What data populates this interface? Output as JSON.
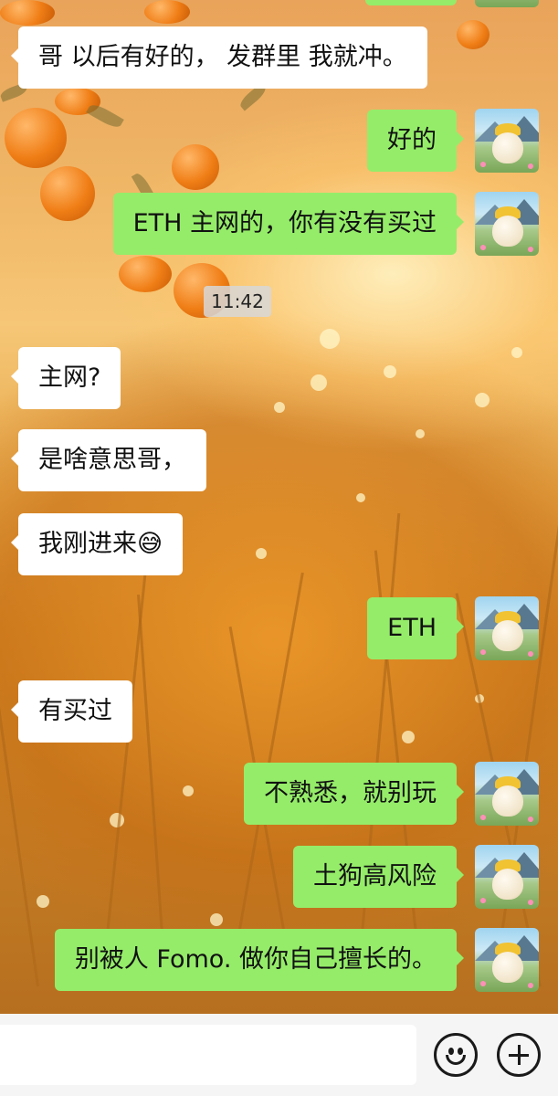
{
  "time_divider": "11:42",
  "messages": [
    {
      "side": "right",
      "text": ""
    },
    {
      "side": "left",
      "text": "哥 以后有好的， 发群里 我就冲。"
    },
    {
      "side": "right",
      "text": "好的"
    },
    {
      "side": "right",
      "text": "ETH 主网的，你有没有买过"
    },
    {
      "side": "left",
      "text": "主网?"
    },
    {
      "side": "left",
      "text": "是啥意思哥，"
    },
    {
      "side": "left",
      "text": "我刚进来😅"
    },
    {
      "side": "right",
      "text": "ETH"
    },
    {
      "side": "left",
      "text": "有买过"
    },
    {
      "side": "right",
      "text": "不熟悉，就别玩"
    },
    {
      "side": "right",
      "text": "土狗高风险"
    },
    {
      "side": "right",
      "text": "别被人 Fomo. 做你自己擅长的。"
    }
  ],
  "colors": {
    "outgoing_bubble": "#95ec69",
    "incoming_bubble": "#ffffff",
    "input_bar": "#f5f5f5"
  },
  "input_bar": {
    "message_input_value": "",
    "emoji_icon": "smiley-icon",
    "more_icon": "plus-circle-icon"
  }
}
